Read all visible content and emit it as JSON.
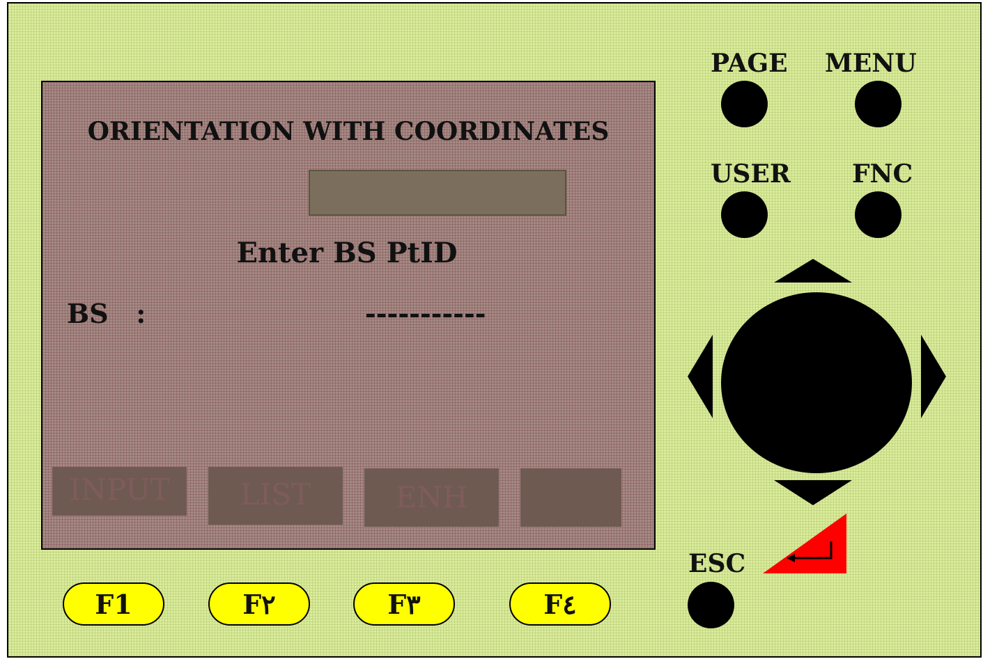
{
  "screen": {
    "title": "ORIENTATION WITH COORDINATES",
    "input_value": "",
    "prompt": "Enter BS PtID",
    "field_label": "BS   :",
    "field_value": "-----------"
  },
  "softkeys": [
    "INPUT",
    "LIST",
    "ENH",
    ""
  ],
  "function_keys": [
    "F1",
    "F٢",
    "F٣",
    "F٤"
  ],
  "buttons": {
    "page": "PAGE",
    "menu": "MENU",
    "user": "USER",
    "fnc": "FNC",
    "esc": "ESC"
  },
  "colors": {
    "body_background": "#d9ec9b",
    "screen_background": "#a48a84",
    "function_key": "#ffff00",
    "enter_key": "#ff0000"
  },
  "icons": {
    "enter": "enter-return-icon",
    "navigation": "directional-pad-icon"
  }
}
